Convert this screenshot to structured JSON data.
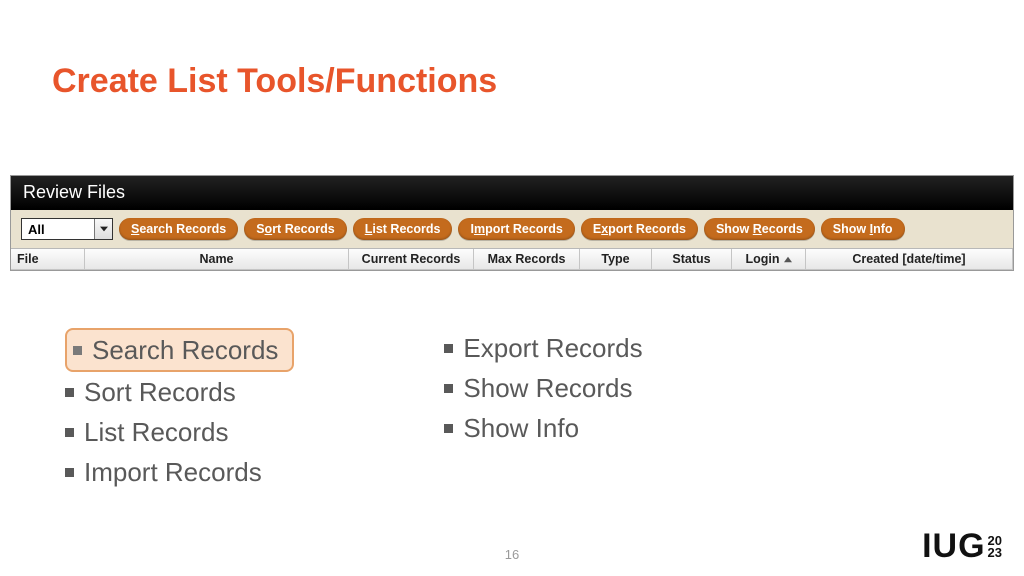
{
  "slide": {
    "title": "Create List Tools/Functions",
    "page_number": "16"
  },
  "app": {
    "panel_title": "Review Files",
    "filter_value": "All",
    "buttons": [
      {
        "pre": "",
        "u": "S",
        "post": "earch Records"
      },
      {
        "pre": "S",
        "u": "o",
        "post": "rt Records"
      },
      {
        "pre": "",
        "u": "L",
        "post": "ist Records"
      },
      {
        "pre": "I",
        "u": "m",
        "post": "port Records"
      },
      {
        "pre": "E",
        "u": "x",
        "post": "port Records"
      },
      {
        "pre": "Show ",
        "u": "R",
        "post": "ecords"
      },
      {
        "pre": "Show ",
        "u": "I",
        "post": "nfo"
      }
    ],
    "columns": {
      "file": "File",
      "name": "Name",
      "current": "Current Records",
      "max": "Max Records",
      "type": "Type",
      "status": "Status",
      "login": "Login",
      "created": "Created [date/time]"
    }
  },
  "bullets": {
    "left": [
      "Search Records",
      "Sort Records",
      "List Records",
      "Import Records"
    ],
    "right": [
      "Export Records",
      "Show Records",
      "Show Info"
    ]
  },
  "logo": {
    "text": "IUG",
    "y1": "20",
    "y2": "23"
  }
}
